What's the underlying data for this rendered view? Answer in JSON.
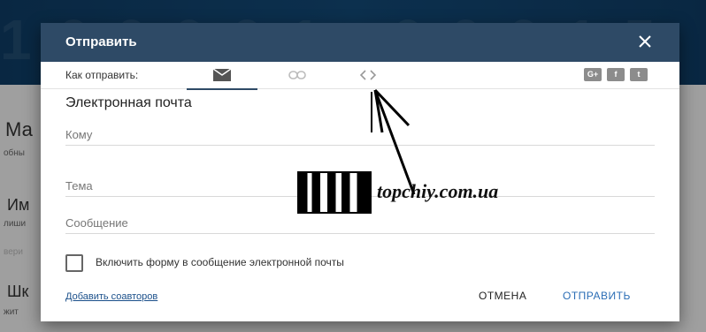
{
  "background": {
    "fragments": [
      "Ма",
      "обны",
      "Им",
      "лиши",
      "вери",
      "Шк",
      "жит"
    ]
  },
  "dialog": {
    "title": "Отправить",
    "how_label": "Как отправить:",
    "tabs": [
      "email",
      "link",
      "embed"
    ],
    "social": [
      "G+",
      "f",
      "t"
    ],
    "section_title": "Электронная почта",
    "fields": {
      "to": "Кому",
      "subject": "Тема",
      "message": "Сообщение"
    },
    "checkbox_label": "Включить форму в сообщение электронной почты",
    "add_coauthors": "Добавить соавторов",
    "cancel": "ОТМЕНА",
    "send": "ОТПРАВИТЬ"
  },
  "watermark": "topchiy.com.ua",
  "colors": {
    "header": "#2e4a66",
    "send": "#2a6db5",
    "link": "#1a4f8a"
  }
}
